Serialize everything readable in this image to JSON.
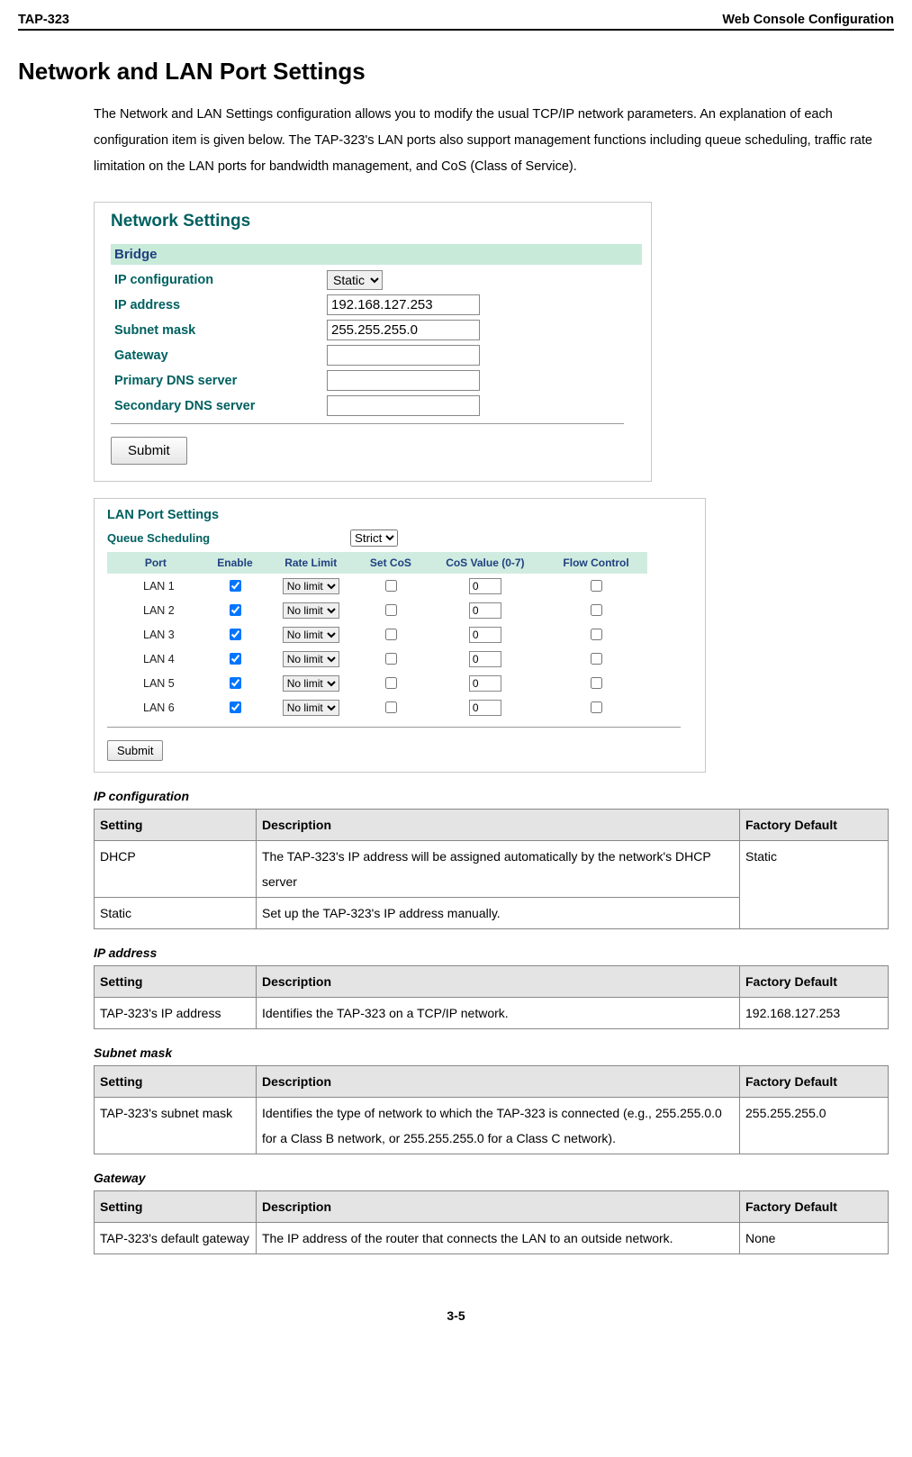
{
  "header": {
    "left": "TAP-323",
    "right": "Web Console Configuration"
  },
  "heading": "Network and LAN Port Settings",
  "intro": "The Network and LAN Settings configuration allows you to modify the usual TCP/IP network parameters. An explanation of each configuration item is given below. The TAP-323's LAN ports also support management functions including queue scheduling, traffic rate limitation on the LAN ports for bandwidth management, and CoS (Class of Service).",
  "network_settings": {
    "panel_title": "Network Settings",
    "bridge_label": "Bridge",
    "fields": {
      "ip_config": {
        "label": "IP configuration",
        "value": "Static"
      },
      "ip_address": {
        "label": "IP address",
        "value": "192.168.127.253"
      },
      "subnet_mask": {
        "label": "Subnet mask",
        "value": "255.255.255.0"
      },
      "gateway": {
        "label": "Gateway",
        "value": ""
      },
      "primary_dns": {
        "label": "Primary DNS server",
        "value": ""
      },
      "secondary_dns": {
        "label": "Secondary DNS server",
        "value": ""
      }
    },
    "submit_label": "Submit"
  },
  "lan_port_settings": {
    "panel_title": "LAN Port Settings",
    "queue_label": "Queue Scheduling",
    "queue_value": "Strict",
    "columns": [
      "Port",
      "Enable",
      "Rate Limit",
      "Set CoS",
      "CoS Value (0-7)",
      "Flow Control"
    ],
    "rows": [
      {
        "port": "LAN 1",
        "enable": true,
        "rate": "No limit",
        "setcos": false,
        "cos": "0",
        "flow": false
      },
      {
        "port": "LAN 2",
        "enable": true,
        "rate": "No limit",
        "setcos": false,
        "cos": "0",
        "flow": false
      },
      {
        "port": "LAN 3",
        "enable": true,
        "rate": "No limit",
        "setcos": false,
        "cos": "0",
        "flow": false
      },
      {
        "port": "LAN 4",
        "enable": true,
        "rate": "No limit",
        "setcos": false,
        "cos": "0",
        "flow": false
      },
      {
        "port": "LAN 5",
        "enable": true,
        "rate": "No limit",
        "setcos": false,
        "cos": "0",
        "flow": false
      },
      {
        "port": "LAN 6",
        "enable": true,
        "rate": "No limit",
        "setcos": false,
        "cos": "0",
        "flow": false
      }
    ],
    "submit_label": "Submit"
  },
  "tables": {
    "ip_config": {
      "title": "IP configuration",
      "head": [
        "Setting",
        "Description",
        "Factory Default"
      ],
      "rows": [
        {
          "setting": "DHCP",
          "desc": "The TAP-323's IP address will be assigned automatically by the network's DHCP server",
          "def": "Static",
          "rowspan_def": 2
        },
        {
          "setting": "Static",
          "desc": "Set up the TAP-323's IP address manually."
        }
      ]
    },
    "ip_address": {
      "title": "IP address",
      "head": [
        "Setting",
        "Description",
        "Factory Default"
      ],
      "rows": [
        {
          "setting": "TAP-323's IP address",
          "desc": "Identifies the TAP-323 on a TCP/IP network.",
          "def": "192.168.127.253"
        }
      ]
    },
    "subnet_mask": {
      "title": "Subnet mask",
      "head": [
        "Setting",
        "Description",
        "Factory Default"
      ],
      "rows": [
        {
          "setting": "TAP-323's subnet mask",
          "desc": "Identifies the type of network to which the TAP-323 is connected (e.g., 255.255.0.0 for a Class B network, or 255.255.255.0 for a Class C network).",
          "def": "255.255.255.0"
        }
      ]
    },
    "gateway": {
      "title": "Gateway",
      "head": [
        "Setting",
        "Description",
        "Factory Default"
      ],
      "rows": [
        {
          "setting": "TAP-323's default gateway",
          "desc": "The IP address of the router that connects the LAN to an outside network.",
          "def": "None"
        }
      ]
    }
  },
  "page_number": "3-5"
}
